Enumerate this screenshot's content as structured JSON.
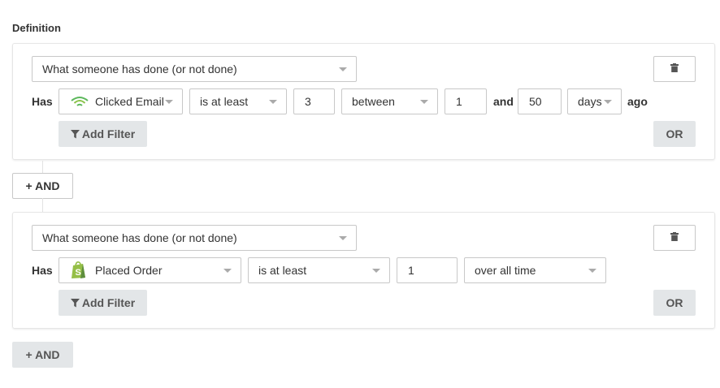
{
  "definition_title": "Definition",
  "groups": [
    {
      "condition_type": "What someone has done (or not done)",
      "has_label": "Has",
      "metric": {
        "label": "Clicked Email",
        "icon": "wifi-icon",
        "icon_color": "#5cb85c"
      },
      "operator": "is at least",
      "count": "3",
      "time_mode": "between",
      "range_start": "1",
      "and_label": "and",
      "range_end": "50",
      "unit": "days",
      "ago_label": "ago",
      "add_filter_label": "Add Filter",
      "or_label": "OR"
    },
    {
      "condition_type": "What someone has done (or not done)",
      "has_label": "Has",
      "metric": {
        "label": "Placed Order",
        "icon": "shopify-icon",
        "icon_color": "#95bf47"
      },
      "operator": "is at least",
      "count": "1",
      "time_mode": "over all time",
      "add_filter_label": "Add Filter",
      "or_label": "OR"
    }
  ],
  "and_buttons": [
    {
      "label": "+ AND"
    },
    {
      "label": "+ AND"
    }
  ]
}
